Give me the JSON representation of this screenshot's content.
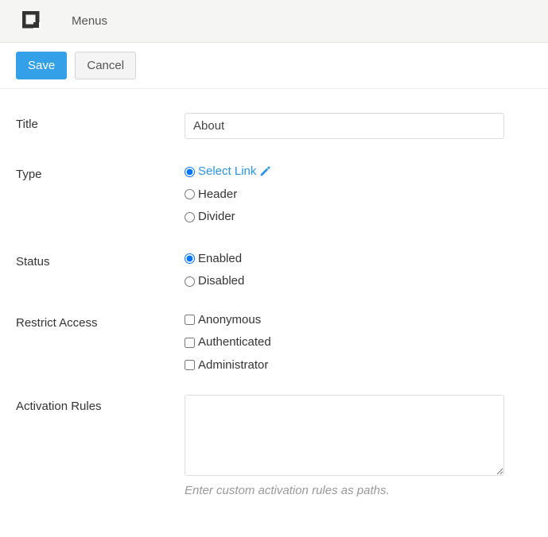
{
  "header": {
    "title": "Menus"
  },
  "toolbar": {
    "save": "Save",
    "cancel": "Cancel"
  },
  "form": {
    "title": {
      "label": "Title",
      "value": "About"
    },
    "type": {
      "label": "Type",
      "options": {
        "select_link": "Select Link",
        "header": "Header",
        "divider": "Divider"
      }
    },
    "status": {
      "label": "Status",
      "options": {
        "enabled": "Enabled",
        "disabled": "Disabled"
      }
    },
    "restrict": {
      "label": "Restrict Access",
      "options": {
        "anonymous": "Anonymous",
        "authenticated": "Authenticated",
        "administrator": "Administrator"
      }
    },
    "activation": {
      "label": "Activation Rules",
      "help": "Enter custom activation rules as paths."
    }
  }
}
